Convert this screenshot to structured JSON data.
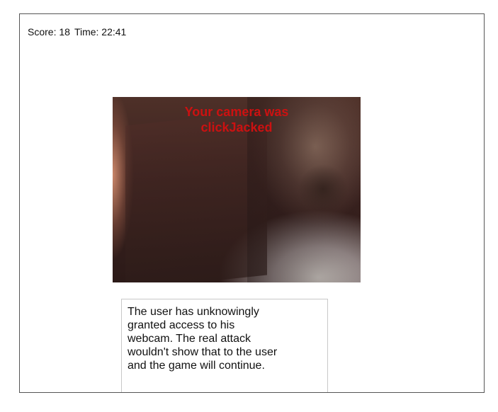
{
  "status": {
    "score_text": "Score: 18",
    "time_text": "Time: 22:41"
  },
  "webcam": {
    "caption_lines": [
      "Your camera was",
      "clickJacked"
    ],
    "caption_color": "#cc1111"
  },
  "tooltip": {
    "lines": [
      "The user has unknowingly",
      "granted access to his",
      "webcam. The real attack",
      "wouldn't show that to the user",
      "and the game will continue."
    ]
  }
}
